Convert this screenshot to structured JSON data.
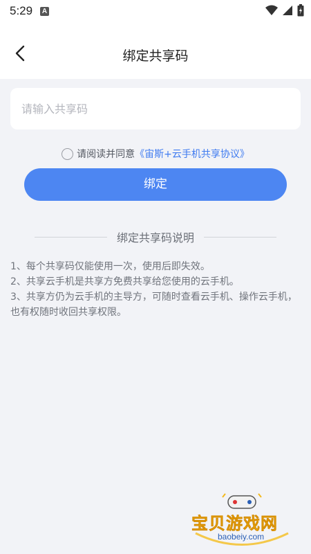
{
  "status_bar": {
    "time": "5:29",
    "notification_badge": "A",
    "icons": [
      "wifi-icon",
      "signal-icon",
      "battery-icon"
    ]
  },
  "header": {
    "title": "绑定共享码",
    "back_icon": "chevron-left-icon"
  },
  "form": {
    "input_placeholder": "请输入共享码",
    "input_value": "",
    "agree_text": "请阅读并同意",
    "agree_link": "《宙斯+云手机共享协议》",
    "agree_checked": false,
    "bind_button_label": "绑定"
  },
  "instructions": {
    "title": "绑定共享码说明",
    "items": [
      "1、每个共享码仅能使用一次，使用后即失效。",
      "2、共享云手机是共享方免费共享给您使用的云手机。",
      "3、共享方仍为云手机的主导方，可随时查看云手机、操作云手机，也有权随时收回共享权限。"
    ]
  },
  "watermark": {
    "text": "宝贝游戏网",
    "url": "baobeiy.com"
  },
  "colors": {
    "background": "#f2f3f7",
    "primary": "#4d86f2",
    "link": "#3f7bf0"
  }
}
